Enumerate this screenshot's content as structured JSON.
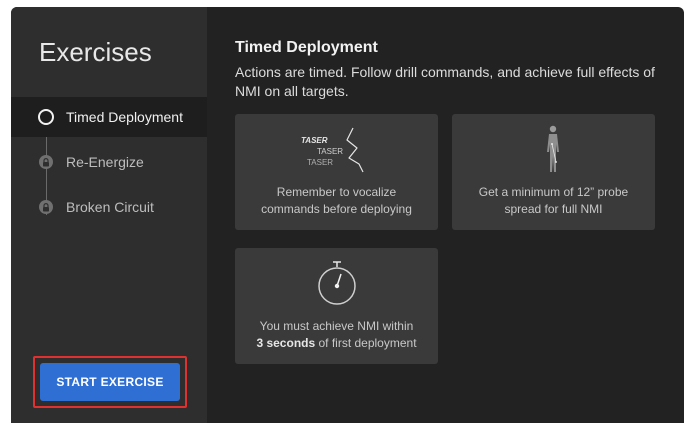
{
  "sidebar": {
    "title": "Exercises",
    "items": [
      {
        "label": "Timed Deployment",
        "state": "active"
      },
      {
        "label": "Re-Energize",
        "state": "locked"
      },
      {
        "label": "Broken Circuit",
        "state": "locked"
      }
    ],
    "start_label": "START EXERCISE"
  },
  "main": {
    "title": "Timed Deployment",
    "description": "Actions are timed. Follow drill commands, and achieve full effects of NMI on all targets.",
    "cards": [
      {
        "icon": "taser-voice-icon",
        "art_words": [
          "TASER",
          "TASER",
          "TASER"
        ],
        "caption_line1": "Remember to vocalize",
        "caption_line2": "commands before deploying"
      },
      {
        "icon": "human-figure-icon",
        "caption_line1": "Get a minimum of 12” probe",
        "caption_line2": "spread for full NMI"
      },
      {
        "icon": "stopwatch-icon",
        "caption_line1": "You must achieve NMI within",
        "caption_bold": "3 seconds",
        "caption_line2_rest": " of first deployment"
      }
    ]
  },
  "colors": {
    "sidebar_bg": "#2e2e2e",
    "content_bg": "#222222",
    "card_bg": "#3a3a3a",
    "primary_button": "#2f6fd4",
    "highlight_border": "#e03131"
  }
}
